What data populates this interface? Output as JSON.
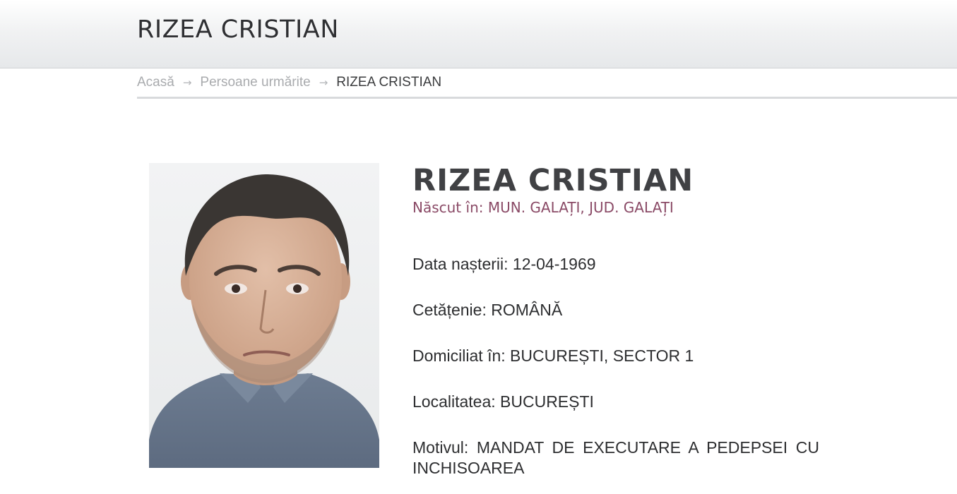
{
  "header": {
    "title": "RIZEA CRISTIAN"
  },
  "breadcrumb": {
    "items": [
      "Acasă",
      "Persoane urmărite"
    ],
    "current": "RIZEA CRISTIAN",
    "separator_icon": "arrow-right-icon"
  },
  "person": {
    "name": "RIZEA CRISTIAN",
    "birthplace": "Născut în: MUN. GALAȚI, JUD. GALAȚI",
    "fields": [
      "Data nașterii: 12-04-1969",
      "Cetățenie: ROMÂNĂ",
      "Domiciliat în: BUCUREȘTI, SECTOR 1",
      "Localitatea: BUCUREȘTI",
      "Motivul: MANDAT DE EXECUTARE A PEDEPSEI CU INCHISOAREA"
    ]
  },
  "colors": {
    "birthplace": "#8a4a66",
    "text": "#2d2e30",
    "breadcrumb_muted": "#a9abae"
  }
}
